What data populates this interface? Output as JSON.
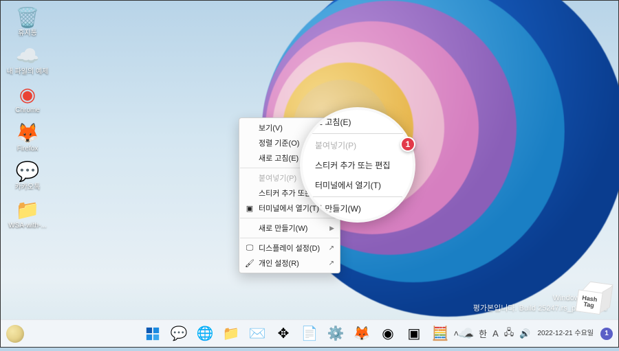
{
  "desktop_icons": [
    {
      "id": "recycle-bin",
      "label": "휴지통",
      "glyph": "🗑️"
    },
    {
      "id": "onedrive",
      "label": "내 파일의 예제",
      "glyph": "☁️",
      "color": "#0a84d8"
    },
    {
      "id": "chrome",
      "label": "Chrome",
      "glyph": "◉",
      "color": "#ea4335"
    },
    {
      "id": "firefox",
      "label": "Firefox",
      "glyph": "🦊"
    },
    {
      "id": "kakaotalk",
      "label": "카카오톡",
      "glyph": "💬",
      "color": "#fae100"
    },
    {
      "id": "wsa-folder",
      "label": "WSA-with-...",
      "glyph": "📁"
    }
  ],
  "context_menu": {
    "items": [
      {
        "label": "보기(V)",
        "has_submenu": true
      },
      {
        "label": "정렬 기준(O)",
        "has_submenu": true
      },
      {
        "label": "새로 고침(E)"
      },
      {
        "sep": true
      },
      {
        "label": "붙여넣기(P)",
        "disabled": true
      },
      {
        "label": "스티커 추가 또는 편집"
      },
      {
        "label": "터미널에서 열기(T)",
        "icon": "▣"
      },
      {
        "sep": true
      },
      {
        "label": "새로 만들기(W)",
        "has_submenu": true
      },
      {
        "sep": true
      },
      {
        "label": "디스플레이 설정(D)",
        "icon": "🖵",
        "link": true
      },
      {
        "label": "개인 설정(R)",
        "icon": "🖌",
        "link": true
      }
    ]
  },
  "zoom": {
    "items": [
      {
        "label": "로 고침(E)"
      },
      {
        "sep": true
      },
      {
        "label": "붙여넣기(P)",
        "disabled": true
      },
      {
        "label": "스티커 추가 또는 편집"
      },
      {
        "label": "터미널에서 열기(T)"
      },
      {
        "sep": true
      },
      {
        "label": "로 만들기(W)"
      }
    ],
    "badge": "1"
  },
  "watermark": {
    "line1": "Windows 11 Pro",
    "line2": "평가본입니다. Build 25247.rs_prerelease"
  },
  "taskbar": {
    "center": [
      {
        "id": "start",
        "name": "start-button"
      },
      {
        "id": "chat",
        "name": "chat-icon",
        "glyph": "💬"
      },
      {
        "id": "edge",
        "name": "edge-icon",
        "glyph": "🌐"
      },
      {
        "id": "explorer",
        "name": "file-explorer-icon",
        "glyph": "📁"
      },
      {
        "id": "mail",
        "name": "mail-icon",
        "glyph": "✉️"
      },
      {
        "id": "move",
        "name": "move-icon",
        "glyph": "✥"
      },
      {
        "id": "notepad",
        "name": "notepad-icon",
        "glyph": "📄"
      },
      {
        "id": "settings",
        "name": "settings-icon",
        "glyph": "⚙️"
      },
      {
        "id": "firefox-tb",
        "name": "firefox-icon",
        "glyph": "🦊"
      },
      {
        "id": "chrome-tb",
        "name": "chrome-icon",
        "glyph": "◉"
      },
      {
        "id": "cmd",
        "name": "terminal-icon",
        "glyph": "▣"
      },
      {
        "id": "calc",
        "name": "calculator-icon",
        "glyph": "🧮"
      },
      {
        "id": "onedrive-tb",
        "name": "onedrive-icon",
        "glyph": "☁️"
      }
    ],
    "tray": {
      "chevron": "˄",
      "cloud": "☁",
      "ime": "A",
      "network": "🖧",
      "volume": "🔊"
    },
    "clock": {
      "date": "2022-12-21 수요일"
    },
    "notif_count": "1"
  },
  "stamp": "Hash\nTag"
}
